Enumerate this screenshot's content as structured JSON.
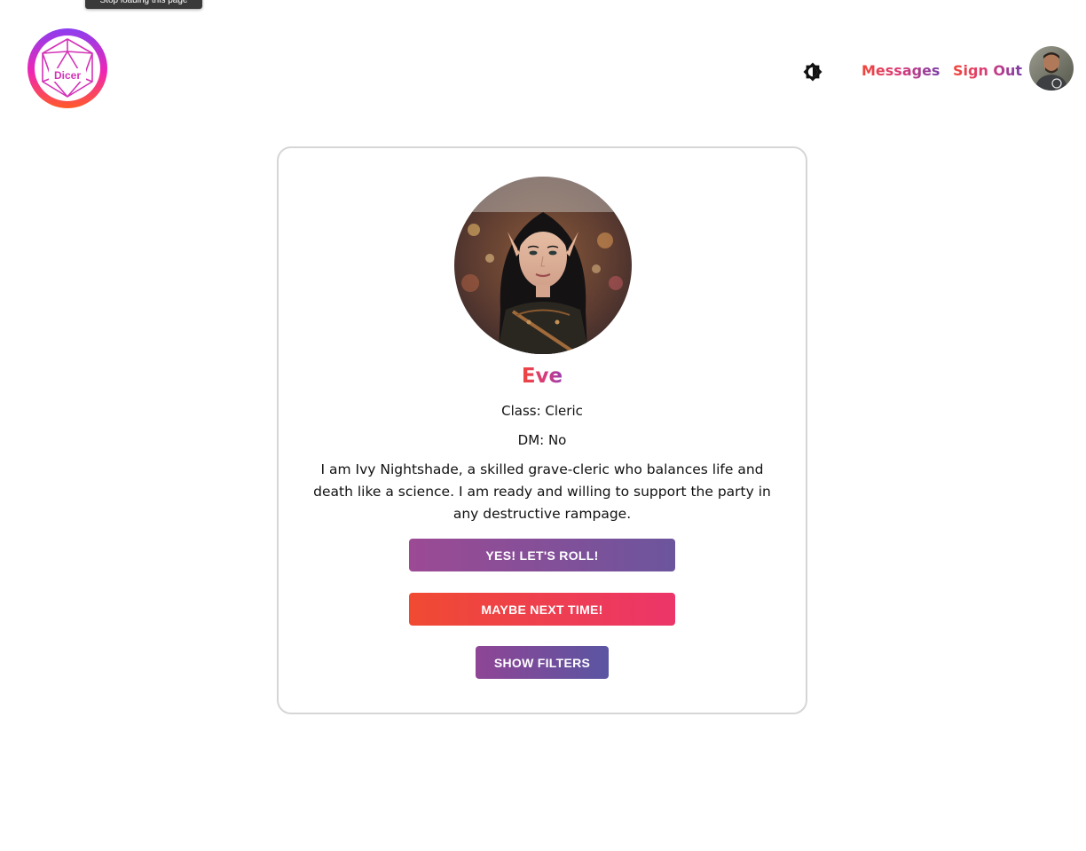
{
  "browser": {
    "tooltip": "Stop loading this page"
  },
  "header": {
    "logo_text": "Dicer",
    "theme_toggle_icon": "brightness-icon",
    "nav": {
      "messages_label": "Messages",
      "signout_label": "Sign Out"
    },
    "user_avatar_icon": "user-avatar"
  },
  "profile": {
    "name": "Eve",
    "class_line": "Class: Cleric",
    "dm_line": "DM: No",
    "bio": "I am Ivy Nightshade, a skilled grave-cleric who balances life and death like a science. I am ready and willing to support the party in any destructive rampage."
  },
  "actions": {
    "yes_label": "YES! LET'S ROLL!",
    "maybe_label": "MAYBE NEXT TIME!",
    "filters_label": "SHOW FILTERS"
  },
  "colors": {
    "accent_red": "#f0473a",
    "accent_pink": "#d93b7a",
    "accent_purple": "#7a3fa8",
    "card_border": "#d6d6d6"
  }
}
